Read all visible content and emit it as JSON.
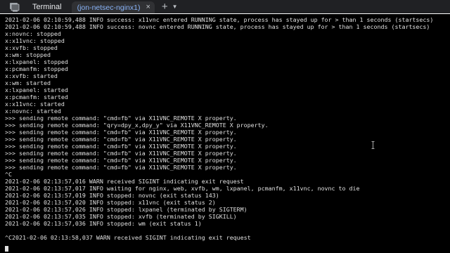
{
  "app": {
    "title": "Terminal",
    "icon": "terminal-app-icon"
  },
  "tabs": [
    {
      "label": "(jon-netsec-nginx1)",
      "active": true
    }
  ],
  "tab_controls": {
    "close_label": "×",
    "add_label": "+",
    "menu_label": "▼"
  },
  "colors": {
    "tabbar_bg": "#202124",
    "tab_active_bg": "#303134",
    "tab_label": "#8ab4f8",
    "terminal_bg": "#000000",
    "terminal_fg": "#e0e0e0"
  },
  "terminal": {
    "lines": [
      "2021-02-06 02:10:59,488 INFO success: x11vnc entered RUNNING state, process has stayed up for > than 1 seconds (startsecs)",
      "2021-02-06 02:10:59,488 INFO success: novnc entered RUNNING state, process has stayed up for > than 1 seconds (startsecs)",
      "x:novnc: stopped",
      "x:x11vnc: stopped",
      "x:xvfb: stopped",
      "x:wm: stopped",
      "x:lxpanel: stopped",
      "x:pcmanfm: stopped",
      "x:xvfb: started",
      "x:wm: started",
      "x:lxpanel: started",
      "x:pcmanfm: started",
      "x:x11vnc: started",
      "x:novnc: started",
      ">>> sending remote command: \"cmd=fb\" via X11VNC_REMOTE X property.",
      ">>> sending remote command: \"qry=dpy_x,dpy_y\" via X11VNC_REMOTE X property.",
      ">>> sending remote command: \"cmd=fb\" via X11VNC_REMOTE X property.",
      ">>> sending remote command: \"cmd=fb\" via X11VNC_REMOTE X property.",
      ">>> sending remote command: \"cmd=fb\" via X11VNC_REMOTE X property.",
      ">>> sending remote command: \"cmd=fb\" via X11VNC_REMOTE X property.",
      ">>> sending remote command: \"cmd=fb\" via X11VNC_REMOTE X property.",
      ">>> sending remote command: \"cmd=fb\" via X11VNC_REMOTE X property.",
      "^C",
      "2021-02-06 02:13:57,016 WARN received SIGINT indicating exit request",
      "2021-02-06 02:13:57,017 INFO waiting for nginx, web, xvfb, wm, lxpanel, pcmanfm, x11vnc, novnc to die",
      "2021-02-06 02:13:57,019 INFO stopped: novnc (exit status 143)",
      "2021-02-06 02:13:57,020 INFO stopped: x11vnc (exit status 2)",
      "2021-02-06 02:13:57,026 INFO stopped: lxpanel (terminated by SIGTERM)",
      "2021-02-06 02:13:57,035 INFO stopped: xvfb (terminated by SIGKILL)",
      "2021-02-06 02:13:57,036 INFO stopped: wm (exit status 1)",
      "",
      "^C2021-02-06 02:13:58,037 WARN received SIGINT indicating exit request"
    ]
  }
}
